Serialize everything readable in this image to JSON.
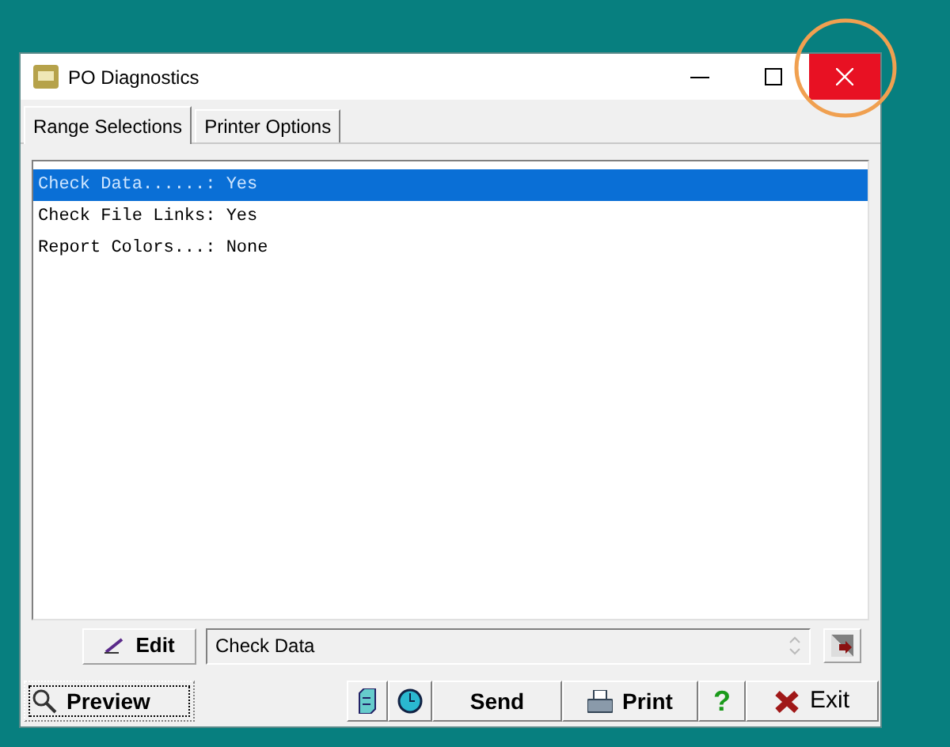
{
  "window": {
    "title": "PO Diagnostics"
  },
  "tabs": [
    {
      "label": "Range Selections",
      "selected": true
    },
    {
      "label": "Printer Options",
      "selected": false
    }
  ],
  "list_items": [
    {
      "text": "Check Data......: Yes",
      "selected": true
    },
    {
      "text": "Check File Links: Yes",
      "selected": false
    },
    {
      "text": "Report Colors...: None",
      "selected": false
    }
  ],
  "edit_button": "Edit",
  "edit_field": {
    "value": "Check Data"
  },
  "bottom_buttons": [
    {
      "kind": "preview",
      "label": "Preview"
    },
    {
      "kind": "file"
    },
    {
      "kind": "clock"
    },
    {
      "kind": "send",
      "label": "Send"
    },
    {
      "kind": "print",
      "label": "Print"
    },
    {
      "kind": "help",
      "label": "?"
    },
    {
      "kind": "exit",
      "label": "Exit"
    }
  ],
  "annotation": {
    "kind": "circle"
  }
}
